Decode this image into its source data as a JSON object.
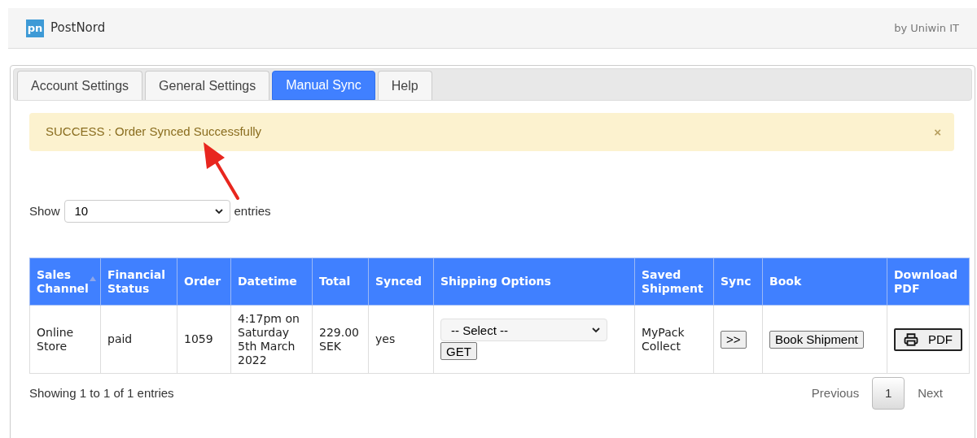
{
  "header": {
    "logo_text": "pn",
    "brand": "PostNord",
    "byline": "by Uniwin IT"
  },
  "tabs": [
    {
      "label": "Account Settings",
      "selected": false
    },
    {
      "label": "General Settings",
      "selected": false
    },
    {
      "label": "Manual Sync",
      "selected": true
    },
    {
      "label": "Help",
      "selected": false
    }
  ],
  "alert": {
    "text": "SUCCESS : Order Synced Successfully",
    "close": "×"
  },
  "length_menu": {
    "label_before": "Show",
    "value": "10",
    "label_after": "entries"
  },
  "table": {
    "columns": [
      {
        "label": "Sales Channel",
        "sorted": true
      },
      {
        "label": "Financial Status",
        "sorted": false
      },
      {
        "label": "Order",
        "sorted": false
      },
      {
        "label": "Datetime",
        "sorted": false
      },
      {
        "label": "Total",
        "sorted": false
      },
      {
        "label": "Synced",
        "sorted": false
      },
      {
        "label": "Shipping Options",
        "sorted": false
      },
      {
        "label": "Saved Shipment",
        "sorted": false
      },
      {
        "label": "Sync",
        "sorted": false
      },
      {
        "label": "Book",
        "sorted": false
      },
      {
        "label": "Download PDF",
        "sorted": false
      }
    ],
    "rows": [
      {
        "cells": [
          {
            "kind": "text",
            "text": "Online Store"
          },
          {
            "kind": "text",
            "text": "paid"
          },
          {
            "kind": "text",
            "text": "1059"
          },
          {
            "kind": "text",
            "text": "4:17pm on Saturday 5th March 2022"
          },
          {
            "kind": "text",
            "text": "229.00 SEK"
          },
          {
            "kind": "text",
            "text": "yes"
          },
          {
            "kind": "select",
            "value": "-- Select --",
            "button": "GET"
          },
          {
            "kind": "text",
            "text": "MyPack Collect"
          },
          {
            "kind": "button",
            "text": ">>"
          },
          {
            "kind": "button",
            "text": "Book Shipment"
          },
          {
            "kind": "pdf",
            "text": "PDF"
          }
        ]
      }
    ]
  },
  "info": "Showing 1 to 1 of 1 entries",
  "pagination": {
    "previous": "Previous",
    "pages": [
      {
        "label": "1",
        "selected": true
      }
    ],
    "next": "Next"
  }
}
